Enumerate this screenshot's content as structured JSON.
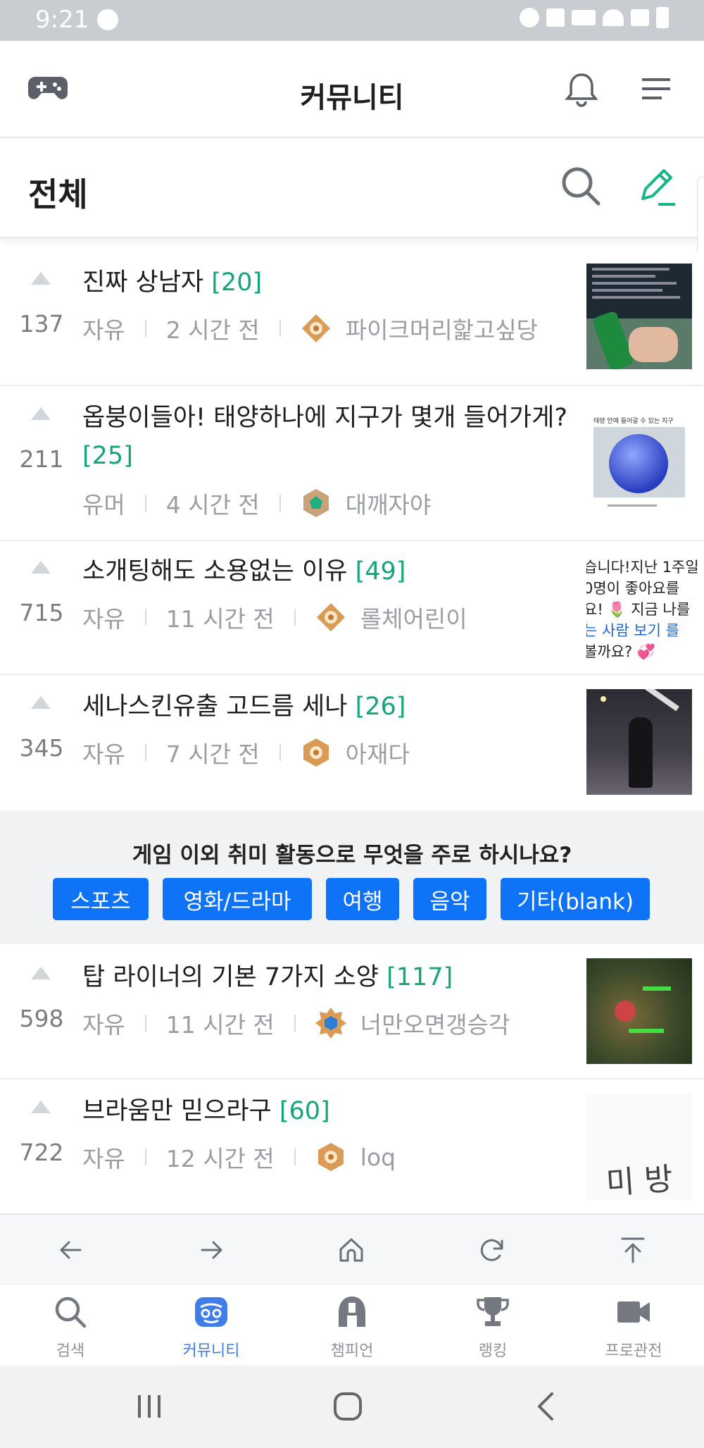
{
  "status": {
    "time": "9:21"
  },
  "header": {
    "title": "커뮤니티"
  },
  "section": {
    "title": "전체"
  },
  "posts": [
    {
      "title": "진짜 상남자",
      "comments": "[20]",
      "votes": "137",
      "category": "자유",
      "time": "2 시간 전",
      "author": "파이크머리핥고싶당",
      "badge_color": "#d99b55"
    },
    {
      "title": "옵붕이들아! 태양하나에 지구가 몇개 들어가게?",
      "comments": "[25]",
      "votes": "211",
      "category": "유머",
      "time": "4 시간 전",
      "author": "대깨자야",
      "badge_color": "#1fae7d"
    },
    {
      "title": "소개팅해도 소용없는 이유",
      "comments": "[49]",
      "votes": "715",
      "category": "자유",
      "time": "11 시간 전",
      "author": "롤체어린이",
      "badge_color": "#d99b55"
    },
    {
      "title": "세나스킨유출 고드름 세나",
      "comments": "[26]",
      "votes": "345",
      "category": "자유",
      "time": "7 시간 전",
      "author": "아재다",
      "badge_color": "#d99b55"
    },
    {
      "title": "탑 라이너의 기본 7가지 소양",
      "comments": "[117]",
      "votes": "598",
      "category": "자유",
      "time": "11 시간 전",
      "author": "너만오면갱승각",
      "badge_color": "#2d7fd6"
    },
    {
      "title": "브라움만 믿으라구",
      "comments": "[60]",
      "votes": "722",
      "category": "자유",
      "time": "12 시간 전",
      "author": "loq",
      "badge_color": "#d99b55"
    }
  ],
  "thumb_texts": {
    "p2_caption": "태양 안에 들어갈 수 있는 지구",
    "p3_lines": [
      "습니다!지난 1주일",
      "0명이 좋아요를",
      "요! 🌷 지금 나를",
      "는 사람 보기 를",
      "볼까요? 💞"
    ],
    "p6_handwriting": "미 방"
  },
  "poll": {
    "question": "게임 이외 취미 활동으로 무엇을 주로 하시나요?",
    "options": [
      "스포츠",
      "영화/드라마",
      "여행",
      "음악",
      "기타(blank)"
    ]
  },
  "bottom_nav": [
    {
      "label": "검색",
      "icon": "search-icon"
    },
    {
      "label": "커뮤니티",
      "icon": "community-icon",
      "active": true
    },
    {
      "label": "챔피언",
      "icon": "helmet-icon"
    },
    {
      "label": "랭킹",
      "icon": "trophy-icon"
    },
    {
      "label": "프로관전",
      "icon": "video-camera-icon"
    }
  ],
  "colors": {
    "accent_green": "#13a67a",
    "poll_blue": "#0e73f6",
    "nav_active": "#3f7ee8"
  }
}
